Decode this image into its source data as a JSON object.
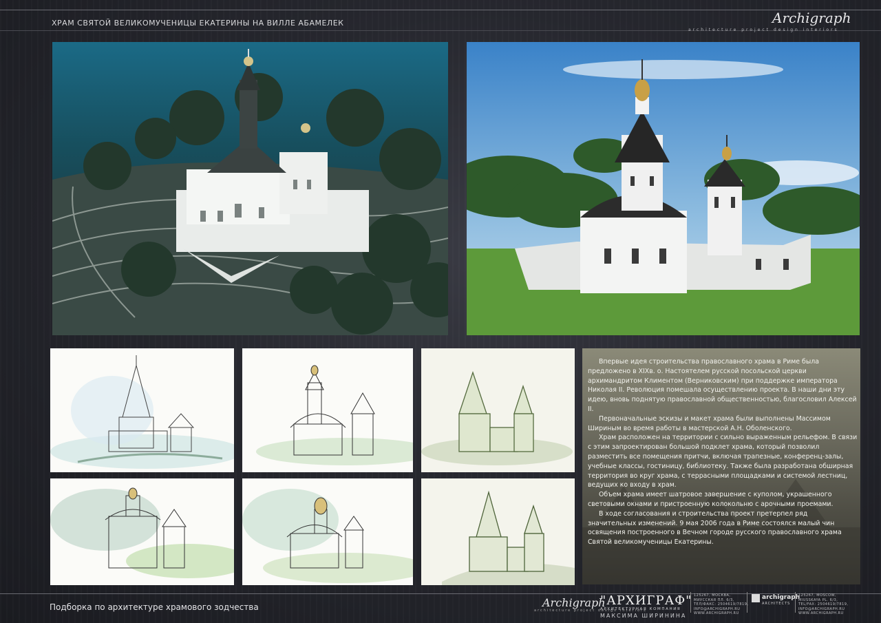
{
  "header": {
    "title": "ХРАМ СВЯТОЙ  ВЕЛИКОМУЧЕНИЦЫ ЕКАТЕРИНЫ НА ВИЛЛЕ АБАМЕЛЕК",
    "signature": "Archigraph",
    "tagline": "architecture  project  design  interiors"
  },
  "description": {
    "paragraphs": [
      "Впервые идея строительства православного храма в Риме была предложено в XIXв. о. Настоятелем русской посольской церкви архимандритом Климентом  (Верниковским) при поддержке императора Николая II. Революция помешала осуществлению проекта. В наши дни эту идею, вновь поднятую православной общественностью, благословил  Алексей II.",
      "Первоначальные эскизы и макет храма  были выполнены Массимом Шириным во время работы в мастерской А.Н.  Оболенского.",
      "Храм  расположен на территории с сильно выраженным рельефом. В связи с этим  запроектирован большой подклет храма, который позволил разместить все помещения притчи, включая трапезные, конференц-залы, учебные классы, гостиницу, библиотеку. Также была разработана  обширная  территория во круг храма, с террасными площадками  и системой лестниц, ведущих ко входу  в храм.",
      "Объем  храма имеет шатровое завершение с куполом, украшенного  световыми окнами и пристроенную колокольню с арочными проемами.",
      "В ходе согласования и строительства  проект претерпел ряд значительных изменений. 9 мая  2006 года в Риме состоялся малый чин освящения построенного в Вечном городе русского православного храма Святой великомученицы Екатерины."
    ]
  },
  "footer": {
    "subtitle": "Подборка по архитектуре храмового зодчества",
    "signature": "Archigraph",
    "signature_tag": "architecture  project  design  interiors",
    "brand": "\"АРХИГРАФ\"",
    "brand_sub": "АРХИТЕКТУРНАЯ КОМПАНИЯ",
    "brand_sub2": "МАКСИМА ШИРИНИНА",
    "address_ru": [
      "125267, МОСКВА,",
      "МИУССКАЯ ПЛ. 6/3,",
      "ТЕЛ/ФАКС: 2504619/7819,",
      "INFO@ARCHIGRAPH.RU",
      "WWW.ARCHIGRAPH.RU"
    ],
    "logo_text": "archigraph",
    "logo_sub": "ARCHITECTS",
    "address_en": [
      "125267, MOSCOW,",
      "MIUSSKAYA PL. 6/3,",
      "TEL/FAX: 2504619/7819,",
      "INFO@ARCHIGRAPH.RU",
      "WWW.ARCHIGRAPH.RU"
    ]
  },
  "colors": {
    "background": "#1d1e24",
    "sky": "#3f86c8",
    "model_bg": "#1f5a6e",
    "grass": "#5d9a3a",
    "roof": "#2a2a2a",
    "wall": "#f2f2f2",
    "gold": "#c8a046"
  }
}
